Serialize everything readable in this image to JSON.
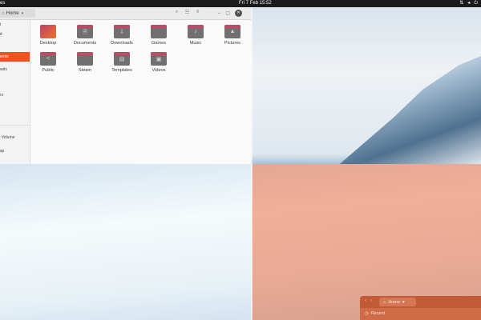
{
  "topbar": {
    "activities": "es",
    "clock": "Fri 7 Feb  15:52",
    "icons": [
      "network-icon",
      "volume-icon",
      "power-icon"
    ]
  },
  "file_manager": {
    "location": "Home",
    "sidebar": [
      {
        "label": "nt",
        "active": false
      },
      {
        "label": "ed",
        "active": false
      },
      {
        "label": "ments",
        "active": true
      },
      {
        "label": "loads",
        "active": false
      },
      {
        "label": "c",
        "active": false
      },
      {
        "label": "res",
        "active": false
      },
      {
        "label": "s",
        "active": false
      },
      {
        "label": "h",
        "active": false
      },
      {
        "label": "B Volume",
        "active": false
      },
      {
        "label": "Lap",
        "active": false
      }
    ],
    "files": [
      {
        "name": "Desktop",
        "icon": "desktop-folder-icon",
        "glyph": ""
      },
      {
        "name": "Documents",
        "icon": "documents-folder-icon",
        "glyph": "🗎"
      },
      {
        "name": "Downloads",
        "icon": "downloads-folder-icon",
        "glyph": "⇩"
      },
      {
        "name": "Games",
        "icon": "games-folder-icon",
        "glyph": ""
      },
      {
        "name": "Music",
        "icon": "music-folder-icon",
        "glyph": "♪"
      },
      {
        "name": "Pictures",
        "icon": "pictures-folder-icon",
        "glyph": "▲"
      },
      {
        "name": "Public",
        "icon": "public-folder-icon",
        "glyph": "<"
      },
      {
        "name": "Steam",
        "icon": "steam-folder-icon",
        "glyph": ""
      },
      {
        "name": "Templates",
        "icon": "templates-folder-icon",
        "glyph": "▤"
      },
      {
        "name": "Videos",
        "icon": "videos-folder-icon",
        "glyph": "▣"
      }
    ]
  },
  "second_window": {
    "location": "Home",
    "sidebar_first": "Recent"
  },
  "colors": {
    "accent": "#e95420",
    "topbar": "#1a1a1a",
    "folder": "#707070",
    "folder_tab": "#c24a67"
  }
}
